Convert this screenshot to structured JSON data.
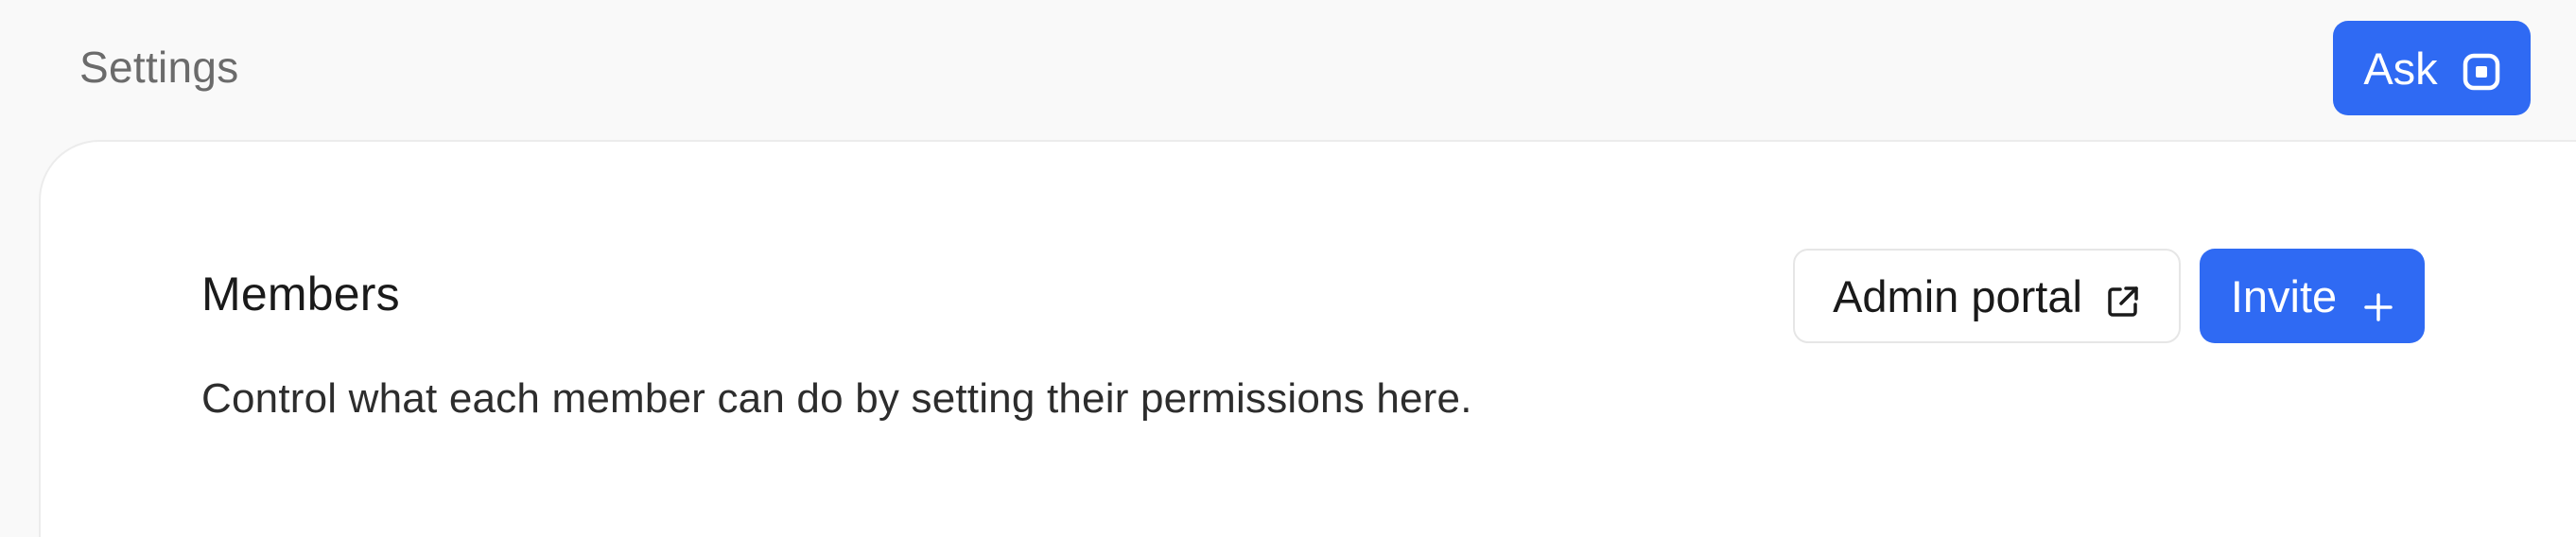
{
  "header": {
    "title": "Settings",
    "ask_label": "Ask",
    "ask_icon": "square-dot-icon"
  },
  "members": {
    "title": "Members",
    "description": "Control what each member can do by setting their permissions here.",
    "admin_portal_label": "Admin portal",
    "admin_portal_icon": "external-link-icon",
    "invite_label": "Invite",
    "invite_icon": "plus-icon"
  },
  "colors": {
    "accent": "#2f6af3",
    "background": "#f9f9f9",
    "card": "#ffffff"
  }
}
